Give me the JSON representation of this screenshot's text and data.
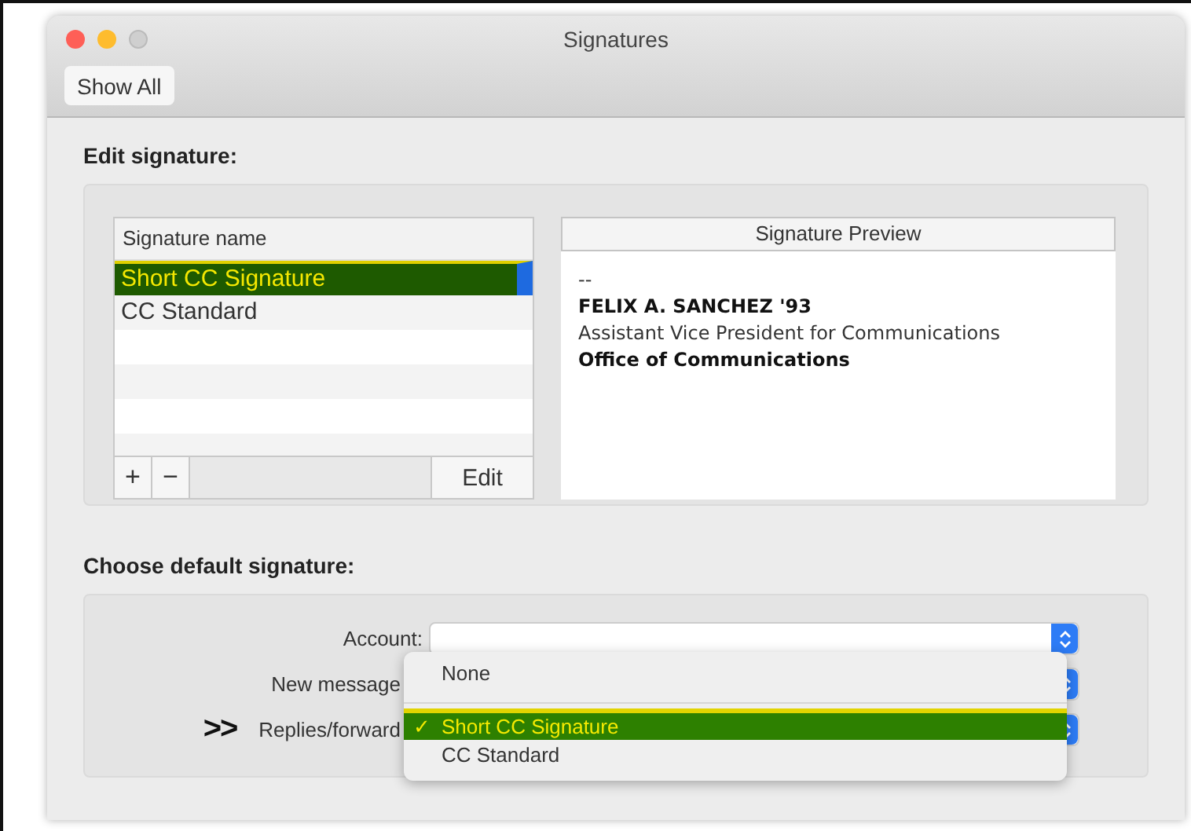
{
  "window": {
    "title": "Signatures"
  },
  "toolbar": {
    "show_all": "Show All"
  },
  "edit_section": {
    "heading": "Edit signature:",
    "list": {
      "header": "Signature name",
      "items": [
        {
          "name": "Short CC Signature",
          "selected": true
        },
        {
          "name": "CC Standard",
          "selected": false
        }
      ],
      "add": "+",
      "remove": "−",
      "edit": "Edit"
    },
    "preview": {
      "header": "Signature Preview",
      "lines": [
        {
          "text": "--",
          "kind": "plain"
        },
        {
          "text": "FELIX A. SANCHEZ '93",
          "kind": "bold"
        },
        {
          "text": "Assistant Vice President for Communications",
          "kind": "plain"
        },
        {
          "text": "Office of Communications",
          "kind": "bold"
        }
      ]
    }
  },
  "default_section": {
    "heading": "Choose default signature:",
    "fields": [
      {
        "label": "Account:"
      },
      {
        "label": "New message"
      },
      {
        "label": "Replies/forward",
        "marker": ">>"
      }
    ]
  },
  "menu": {
    "options": [
      {
        "label": "None",
        "selected": false
      },
      {
        "label": "Short CC Signature",
        "selected": true,
        "check": "✓"
      },
      {
        "label": "CC Standard",
        "selected": false
      }
    ]
  }
}
